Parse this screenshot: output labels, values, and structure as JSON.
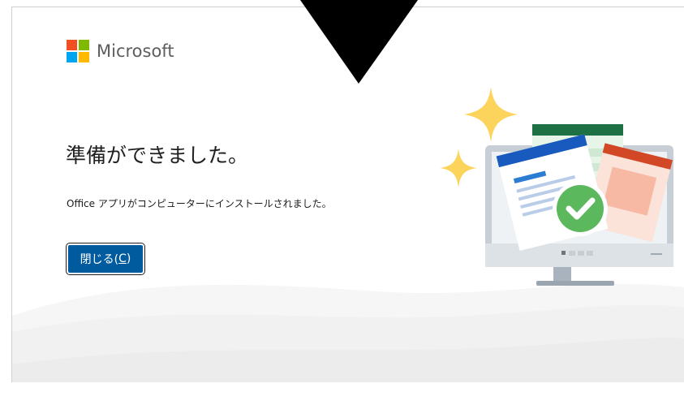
{
  "brand": {
    "name": "Microsoft",
    "colors": [
      "#f25022",
      "#7fba00",
      "#00a4ef",
      "#ffb900"
    ]
  },
  "dialog": {
    "title": "準備ができました。",
    "message": "Office アプリがコンピューターにインストールされました。",
    "close_button": {
      "label_prefix": "閉じる(",
      "accelerator": "C",
      "label_suffix": ")"
    }
  },
  "illustration": {
    "icon": "monitor-with-office-docs-checkmark-illustration",
    "sparkles": "sparkle-icon"
  },
  "colors": {
    "button_bg": "#005a9e",
    "accent_green": "#1e7145",
    "check_green": "#5cb85c"
  }
}
